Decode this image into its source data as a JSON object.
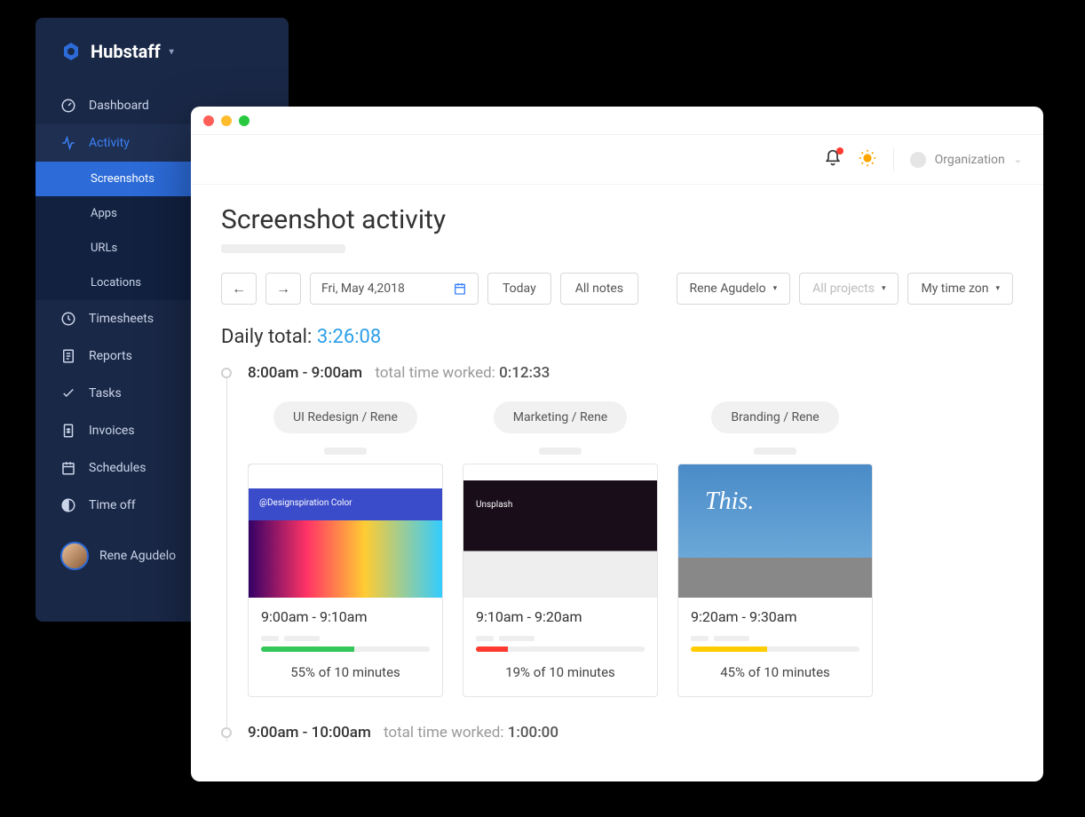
{
  "brand": "Hubstaff",
  "sidebar": {
    "items": [
      {
        "label": "Dashboard",
        "icon": "gauge-icon"
      },
      {
        "label": "Activity",
        "icon": "activity-icon"
      },
      {
        "label": "Timesheets",
        "icon": "clock-icon"
      },
      {
        "label": "Reports",
        "icon": "report-icon"
      },
      {
        "label": "Tasks",
        "icon": "check-icon"
      },
      {
        "label": "Invoices",
        "icon": "invoice-icon"
      },
      {
        "label": "Schedules",
        "icon": "calendar-icon"
      },
      {
        "label": "Time off",
        "icon": "timeoff-icon"
      }
    ],
    "activity_sub": [
      {
        "label": "Screenshots"
      },
      {
        "label": "Apps"
      },
      {
        "label": "URLs"
      },
      {
        "label": "Locations"
      }
    ],
    "user": "Rene Agudelo"
  },
  "topbar": {
    "org_label": "Organization"
  },
  "page_title": "Screenshot activity",
  "filters": {
    "date": "Fri, May 4,2018",
    "today": "Today",
    "all_notes": "All notes",
    "user": "Rene Agudelo",
    "projects": "All projects",
    "timezone": "My time zone"
  },
  "daily_total": {
    "label": "Daily total:",
    "value": "3:26:08"
  },
  "blocks": [
    {
      "range": "8:00am - 9:00am",
      "worked_label": "total time worked:",
      "worked_value": "0:12:33",
      "cards": [
        {
          "pill": "UI Redesign / Rene",
          "time": "9:00am - 9:10am",
          "pct_text": "55% of 10 minutes",
          "pct": 55,
          "color": "#34c759"
        },
        {
          "pill": "Marketing / Rene",
          "time": "9:10am - 9:20am",
          "pct_text": "19% of 10 minutes",
          "pct": 19,
          "color": "#ff3b30"
        },
        {
          "pill": "Branding / Rene",
          "time": "9:20am - 9:30am",
          "pct_text": "45% of 10 minutes",
          "pct": 45,
          "color": "#ffcc00"
        }
      ]
    },
    {
      "range": "9:00am - 10:00am",
      "worked_label": "total time worked:",
      "worked_value": "1:00:00"
    }
  ]
}
